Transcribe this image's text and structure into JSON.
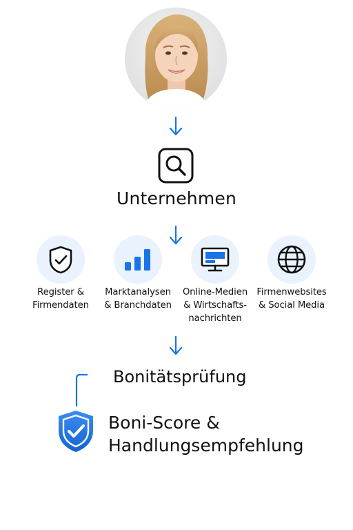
{
  "avatar": {
    "description_icon": "person-portrait"
  },
  "company": {
    "icon": "search-icon",
    "label": "Unternehmen"
  },
  "sources": [
    {
      "icon": "shield-check-icon",
      "label_line1": "Register &",
      "label_line2": "Firmendaten",
      "label_line3": ""
    },
    {
      "icon": "bar-chart-icon",
      "label_line1": "Marktanalysen",
      "label_line2": "& Branchdaten",
      "label_line3": ""
    },
    {
      "icon": "monitor-icon",
      "label_line1": "Online-Medien",
      "label_line2": "& Wirtschafts-",
      "label_line3": "nachrichten"
    },
    {
      "icon": "globe-icon",
      "label_line1": "Firmenwebsites",
      "label_line2": "& Social Media",
      "label_line3": ""
    }
  ],
  "check": {
    "label": "Bonitätsprüfung"
  },
  "result": {
    "icon": "shield-check-icon",
    "line1": "Boni-Score &",
    "line2": "Handlungsempfehlung"
  },
  "colors": {
    "accent": "#1a73e8",
    "circle_bg": "#e9f2fd",
    "text": "#111111"
  }
}
